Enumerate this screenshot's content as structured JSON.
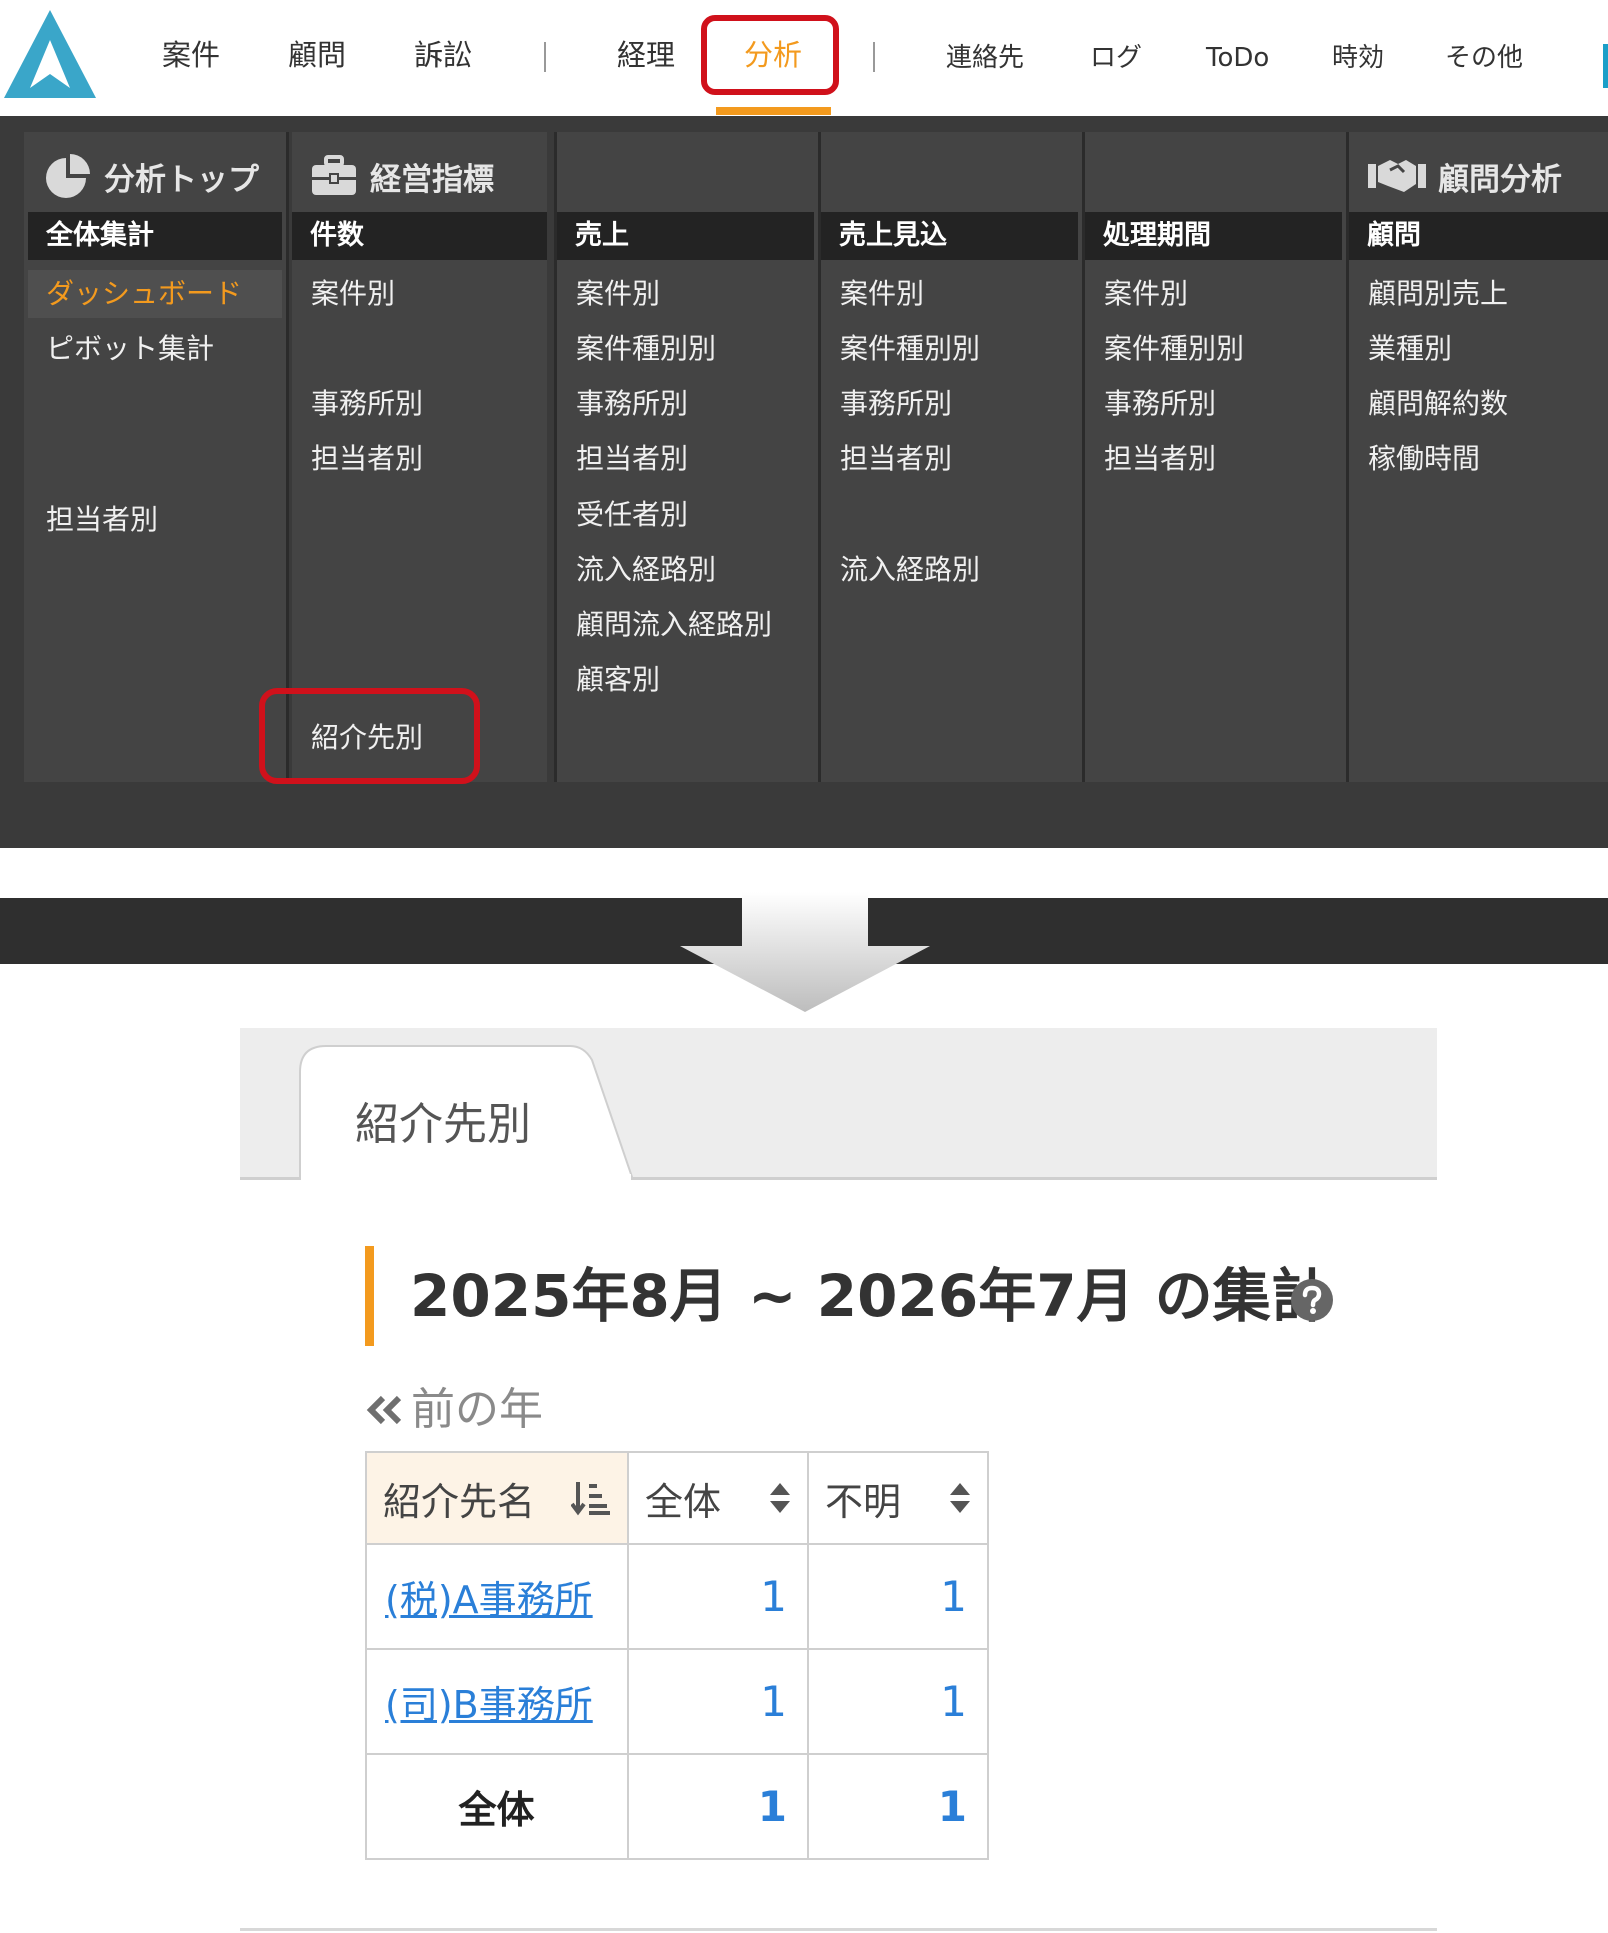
{
  "nav": {
    "items": [
      "案件",
      "顧問",
      "訴訟",
      "経理",
      "分析",
      "連絡先",
      "ログ",
      "ToDo",
      "時効",
      "その他"
    ],
    "active": "分析"
  },
  "menu": {
    "groups": {
      "analysis_top": "分析トップ",
      "management": "経営指標",
      "advisory_analysis": "顧問分析"
    },
    "columns": [
      {
        "header": "全体集計",
        "items": [
          "ダッシュボード",
          "ピボット集計",
          "担当者別"
        ]
      },
      {
        "header": "件数",
        "items": [
          "案件別",
          "事務所別",
          "担当者別",
          "紹介先別"
        ]
      },
      {
        "header": "売上",
        "items": [
          "案件別",
          "案件種別別",
          "事務所別",
          "担当者別",
          "受任者別",
          "流入経路別",
          "顧問流入経路別",
          "顧客別"
        ]
      },
      {
        "header": "売上見込",
        "items": [
          "案件別",
          "案件種別別",
          "事務所別",
          "担当者別",
          "流入経路別"
        ]
      },
      {
        "header": "処理期間",
        "items": [
          "案件別",
          "案件種別別",
          "事務所別",
          "担当者別"
        ]
      },
      {
        "header": "顧問",
        "items": [
          "顧問別売上",
          "業種別",
          "顧問解約数",
          "稼働時間"
        ]
      }
    ]
  },
  "page": {
    "tab_label": "紹介先別",
    "heading": "2025年8月 ~ 2026年7月 の集計",
    "prev_year": "前の年"
  },
  "table": {
    "headers": [
      "紹介先名",
      "全体",
      "不明"
    ],
    "rows": [
      {
        "name": "(税)A事務所",
        "total": "1",
        "unknown": "1"
      },
      {
        "name": "(司)B事務所",
        "total": "1",
        "unknown": "1"
      }
    ],
    "footer": {
      "name": "全体",
      "total": "1",
      "unknown": "1"
    }
  },
  "colors": {
    "accent_orange": "#f39a1e",
    "highlight_red": "#d0111b",
    "logo_blue": "#3aa6c9",
    "link_blue": "#2a7fd8",
    "menu_bg": "#444444"
  },
  "icons": {
    "logo": "app-logo-a",
    "analysis_top": "pie-chart-icon",
    "management": "briefcase-icon",
    "advisory_analysis": "handshake-icon",
    "help": "question-circle-icon",
    "prev": "double-chevron-left-icon",
    "sort_active": "sort-ascending-icon",
    "sort": "sort-updown-icon",
    "arrow": "down-arrow-icon"
  }
}
